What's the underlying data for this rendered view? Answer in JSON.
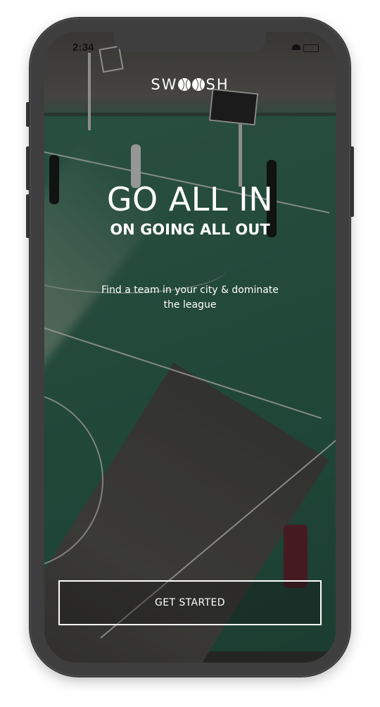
{
  "status_bar": {
    "time": "2:34",
    "icons": [
      "wifi-icon",
      "battery-icon"
    ]
  },
  "brand": {
    "logo_left": "SW",
    "logo_right": "SH",
    "logo_icons": [
      "basketball-icon",
      "basketball-icon"
    ]
  },
  "hero": {
    "headline": "GO ALL IN",
    "subheadline": "ON GOING ALL OUT",
    "tagline": "Find a team in your city & dominate the league"
  },
  "cta": {
    "label": "GET STARTED"
  },
  "theme": {
    "text_color": "#ffffff",
    "court_color": "#3a7560",
    "device_frame": "#3e3e3e"
  }
}
